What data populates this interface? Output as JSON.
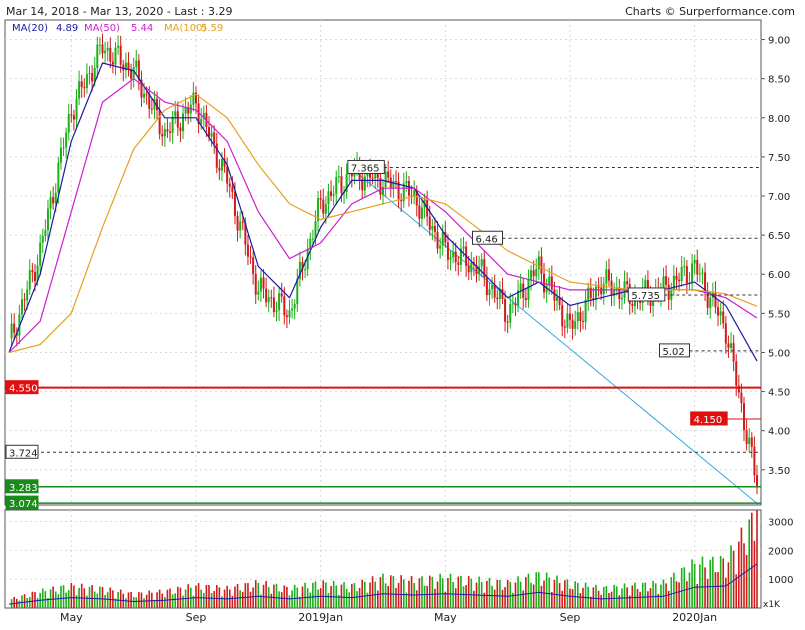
{
  "header": {
    "range": "Mar 14, 2018 - Mar 13, 2020 - Last : 3.29",
    "credit": "Charts © Surperformance.com"
  },
  "legend": [
    {
      "label": "MA(20)",
      "value": "4.89",
      "color": "#1a1aa6"
    },
    {
      "label": "MA(50)",
      "value": "5.44",
      "color": "#cc1fcc"
    },
    {
      "label": "MA(100)",
      "value": "5.59",
      "color": "#e6a020"
    }
  ],
  "price_ticks": [
    "9.00",
    "8.50",
    "8.00",
    "7.50",
    "7.00",
    "6.50",
    "6.00",
    "5.50",
    "5.00",
    "4.50",
    "4.00",
    "3.50"
  ],
  "volume_ticks": [
    "3000",
    "2000",
    "1000"
  ],
  "volume_unit": "x1K",
  "x_labels": [
    "May",
    "Sep",
    "2019Jan",
    "May",
    "Sep",
    "2020Jan"
  ],
  "levels": [
    {
      "label": "4.550",
      "value": 4.55,
      "style": "red-solid"
    },
    {
      "label": "3.724",
      "value": 3.724,
      "style": "dashed"
    },
    {
      "label": "3.283",
      "value": 3.283,
      "style": "green-solid"
    },
    {
      "label": "3.074",
      "value": 3.074,
      "style": "green-solid"
    }
  ],
  "annotations": [
    {
      "label": "7.365",
      "value": 7.365
    },
    {
      "label": "6.46",
      "value": 6.46
    },
    {
      "label": "5.735",
      "value": 5.735
    },
    {
      "label": "5.02",
      "value": 5.02
    },
    {
      "label": "4.150",
      "value": 4.15
    }
  ],
  "colors": {
    "up": "#19b019",
    "down": "#d11a1a",
    "ma20": "#1a1aa6",
    "ma50": "#cc1fcc",
    "ma100": "#e6a020",
    "trend": "#33aadd",
    "grid": "#d9d9d9"
  },
  "chart_data": {
    "type": "line",
    "subtype": "candlestick-with-volume",
    "x_start": "2018-03-14",
    "x_end": "2020-03-13",
    "last": 3.29,
    "ylim": [
      3.05,
      9.25
    ],
    "volume_ylim": [
      0,
      3400
    ],
    "grid": true,
    "x": [
      "2018-03",
      "2018-04",
      "2018-05",
      "2018-06",
      "2018-07",
      "2018-08",
      "2018-09",
      "2018-10",
      "2018-11",
      "2018-12",
      "2019-01",
      "2019-02",
      "2019-03",
      "2019-04",
      "2019-05",
      "2019-06",
      "2019-07",
      "2019-08",
      "2019-09",
      "2019-10",
      "2019-11",
      "2019-12",
      "2020-01",
      "2020-02",
      "2020-03"
    ],
    "series": [
      {
        "name": "close",
        "values": [
          5.1,
          6.3,
          8.1,
          8.9,
          8.6,
          7.8,
          8.2,
          7.2,
          5.8,
          5.5,
          6.9,
          7.3,
          7.2,
          7.0,
          6.3,
          6.1,
          5.5,
          6.1,
          5.3,
          5.9,
          5.7,
          5.8,
          6.1,
          5.3,
          3.3
        ]
      },
      {
        "name": "MA(20)",
        "values": [
          5.0,
          6.0,
          7.7,
          8.7,
          8.6,
          8.0,
          8.0,
          7.4,
          6.1,
          5.7,
          6.6,
          7.2,
          7.2,
          7.1,
          6.5,
          6.1,
          5.7,
          5.9,
          5.6,
          5.7,
          5.8,
          5.8,
          5.9,
          5.6,
          4.89
        ]
      },
      {
        "name": "MA(50)",
        "values": [
          5.0,
          5.4,
          6.8,
          8.2,
          8.5,
          8.2,
          8.1,
          7.7,
          6.8,
          6.2,
          6.4,
          6.9,
          7.1,
          7.1,
          6.8,
          6.4,
          6.0,
          5.9,
          5.8,
          5.8,
          5.8,
          5.8,
          5.8,
          5.7,
          5.44
        ]
      },
      {
        "name": "MA(100)",
        "values": [
          5.0,
          5.1,
          5.5,
          6.6,
          7.6,
          8.1,
          8.3,
          8.0,
          7.4,
          6.9,
          6.7,
          6.8,
          6.9,
          7.0,
          6.9,
          6.6,
          6.3,
          6.1,
          5.9,
          5.85,
          5.8,
          5.8,
          5.8,
          5.75,
          5.59
        ]
      },
      {
        "name": "volume",
        "values": [
          300,
          600,
          800,
          700,
          500,
          600,
          800,
          700,
          900,
          700,
          900,
          800,
          1100,
          1000,
          1100,
          1000,
          900,
          1200,
          900,
          700,
          800,
          900,
          1600,
          1700,
          3400
        ]
      }
    ]
  }
}
